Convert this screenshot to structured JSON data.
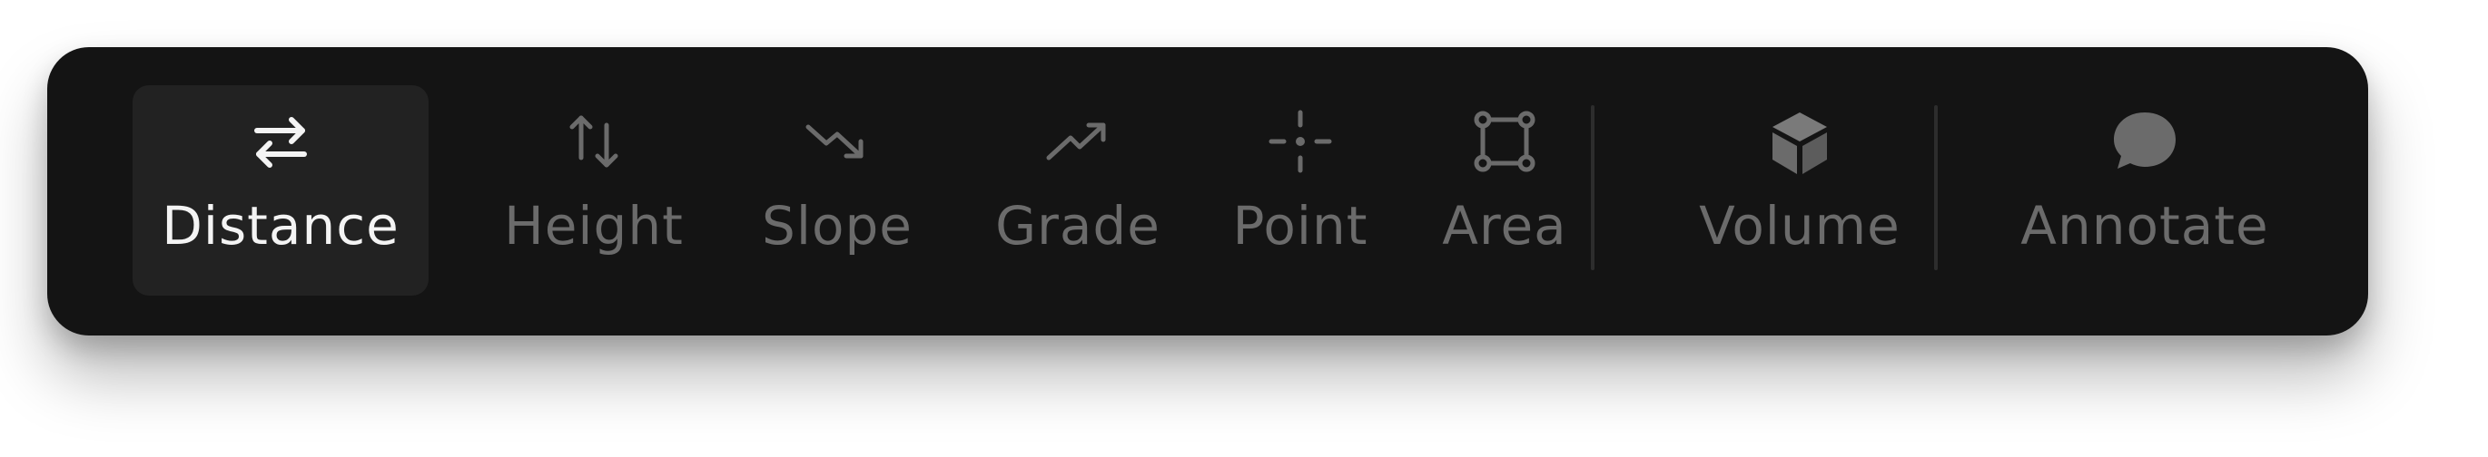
{
  "toolbar": {
    "tools": [
      {
        "id": "distance",
        "label": "Distance",
        "icon": "swap-arrows-icon",
        "active": true
      },
      {
        "id": "height",
        "label": "Height",
        "icon": "up-down-arrows-icon",
        "active": false
      },
      {
        "id": "slope",
        "label": "Slope",
        "icon": "trending-down-icon",
        "active": false
      },
      {
        "id": "grade",
        "label": "Grade",
        "icon": "trending-up-icon",
        "active": false
      },
      {
        "id": "point",
        "label": "Point",
        "icon": "crosshair-point-icon",
        "active": false
      },
      {
        "id": "area",
        "label": "Area",
        "icon": "polygon-area-icon",
        "active": false
      },
      {
        "id": "volume",
        "label": "Volume",
        "icon": "cube-icon",
        "active": false
      },
      {
        "id": "annotate",
        "label": "Annotate",
        "icon": "speech-bubble-icon",
        "active": false
      }
    ]
  },
  "colors": {
    "toolbar_bg": "#141414",
    "active_bg": "#222222",
    "active_text": "#f4f4f4",
    "inactive_text": "#6b6b6b",
    "divider": "#2d2d2d"
  }
}
